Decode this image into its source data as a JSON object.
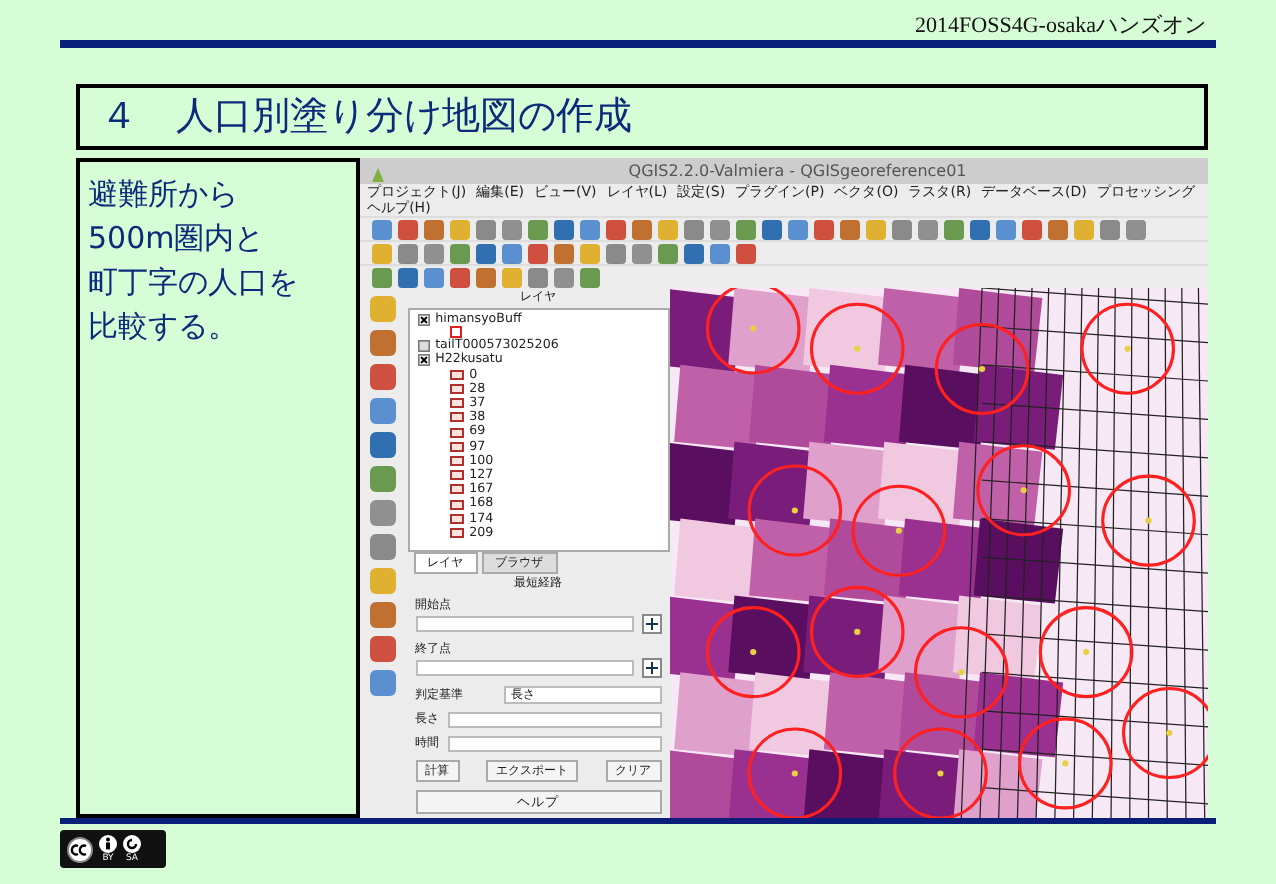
{
  "header": {
    "text": "2014FOSS4G-osakaハンズオン"
  },
  "slide_title": "４　人口別塗り分け地図の作成",
  "description": [
    "避難所から",
    "500m圏内と",
    "町丁字の人口を",
    "比較する。"
  ],
  "app_window": {
    "title": "QGIS2.2.0-Valmiera - QGISgeoreference01",
    "menu": [
      "プロジェクト(J)",
      "編集(E)",
      "ビュー(V)",
      "レイヤ(L)",
      "設定(S)",
      "プラグイン(P)",
      "ベクタ(O)",
      "ラスタ(R)",
      "データベース(D)",
      "プロセッシング",
      "ヘルプ(H)"
    ],
    "layers_panel": {
      "title": "レイヤ",
      "layers": [
        {
          "name": "himansyoBuff",
          "checked": true,
          "legend": [
            {
              "kind": "symbol"
            }
          ]
        },
        {
          "name": "tailT000573025206",
          "checked": false
        },
        {
          "name": "H22kusatu",
          "checked": true,
          "legend": [
            {
              "kind": "class",
              "label": "0"
            },
            {
              "kind": "class",
              "label": "28"
            },
            {
              "kind": "class",
              "label": "37"
            },
            {
              "kind": "class",
              "label": "38"
            },
            {
              "kind": "class",
              "label": "69"
            },
            {
              "kind": "class",
              "label": "97"
            },
            {
              "kind": "class",
              "label": "100"
            },
            {
              "kind": "class",
              "label": "127"
            },
            {
              "kind": "class",
              "label": "167"
            },
            {
              "kind": "class",
              "label": "168"
            },
            {
              "kind": "class",
              "label": "174"
            },
            {
              "kind": "class",
              "label": "209"
            }
          ]
        }
      ]
    },
    "tabs": [
      {
        "label": "レイヤ",
        "selected": true
      },
      {
        "label": "ブラウザ",
        "selected": false
      }
    ],
    "route_panel": {
      "title": "最短経路",
      "start_label": "開始点",
      "end_label": "終了点",
      "criterion_label": "判定基準",
      "criterion_value": "長さ",
      "length_label": "長さ",
      "time_label": "時間",
      "buttons": [
        "計算",
        "エクスポート",
        "クリア"
      ],
      "help": "ヘルプ"
    }
  },
  "license": {
    "texts": [
      "BY",
      "SA"
    ]
  }
}
